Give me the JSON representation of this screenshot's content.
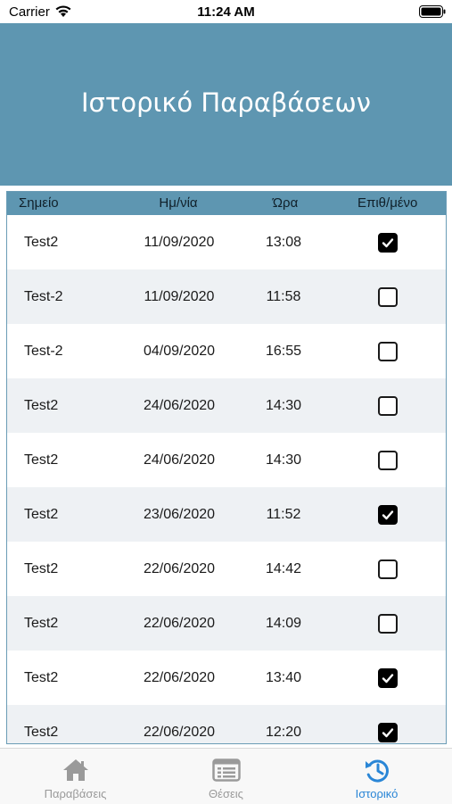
{
  "status_bar": {
    "carrier": "Carrier",
    "time": "11:24 AM"
  },
  "header": {
    "title": "Ιστορικό Παραβάσεων"
  },
  "table": {
    "columns": [
      "Σημείο",
      "Ημ/νία",
      "Ώρα",
      "Επιθ/μένο"
    ],
    "rows": [
      {
        "point": "Test2",
        "date": "11/09/2020",
        "time": "13:08",
        "confirmed": true
      },
      {
        "point": "Test-2",
        "date": "11/09/2020",
        "time": "11:58",
        "confirmed": false
      },
      {
        "point": "Test-2",
        "date": "04/09/2020",
        "time": "16:55",
        "confirmed": false
      },
      {
        "point": "Test2",
        "date": "24/06/2020",
        "time": "14:30",
        "confirmed": false
      },
      {
        "point": "Test2",
        "date": "24/06/2020",
        "time": "14:30",
        "confirmed": false
      },
      {
        "point": "Test2",
        "date": "23/06/2020",
        "time": "11:52",
        "confirmed": true
      },
      {
        "point": "Test2",
        "date": "22/06/2020",
        "time": "14:42",
        "confirmed": false
      },
      {
        "point": "Test2",
        "date": "22/06/2020",
        "time": "14:09",
        "confirmed": false
      },
      {
        "point": "Test2",
        "date": "22/06/2020",
        "time": "13:40",
        "confirmed": true
      },
      {
        "point": "Test2",
        "date": "22/06/2020",
        "time": "12:20",
        "confirmed": true
      }
    ]
  },
  "tabbar": {
    "tabs": [
      {
        "label": "Παραβάσεις",
        "icon": "home-icon",
        "active": false
      },
      {
        "label": "Θέσεις",
        "icon": "list-icon",
        "active": false
      },
      {
        "label": "Ιστορικό",
        "icon": "history-icon",
        "active": true
      }
    ]
  },
  "colors": {
    "header_bg": "#5e96b1",
    "active_tab": "#2a86d6",
    "inactive_tab": "#9a9a9a"
  }
}
